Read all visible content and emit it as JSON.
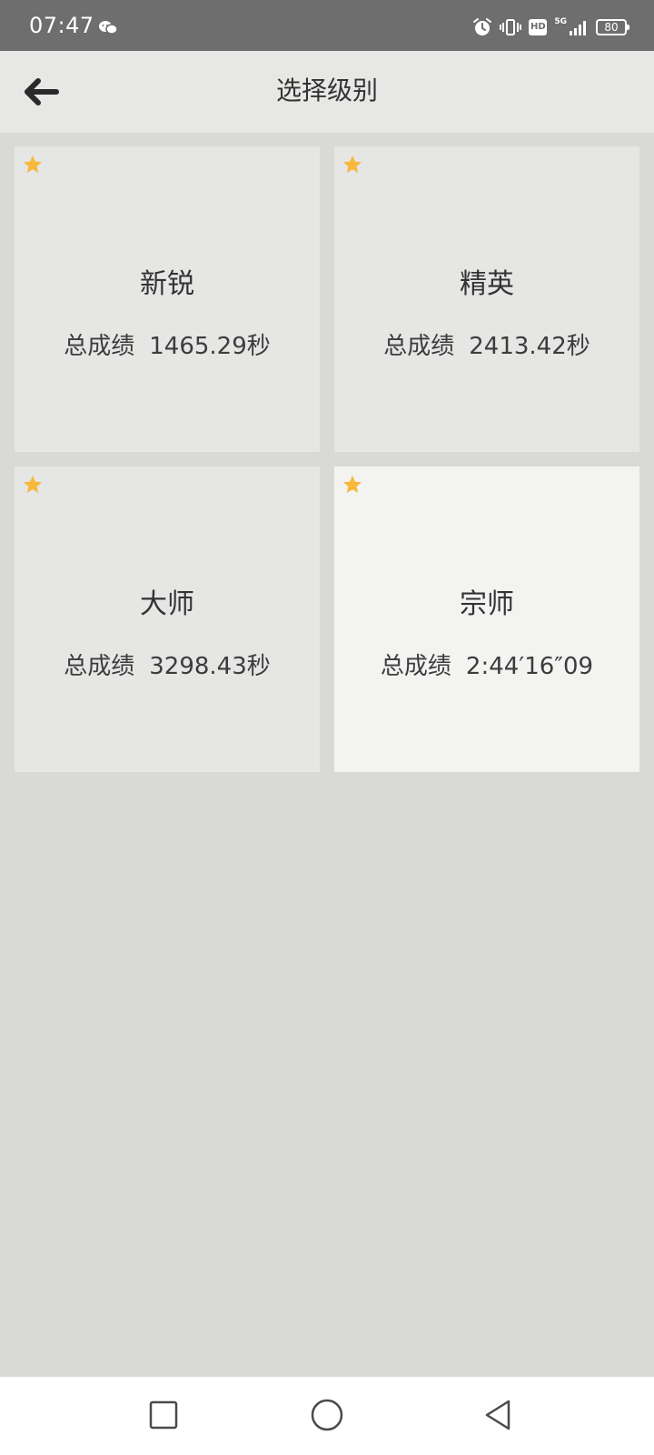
{
  "status_bar": {
    "time": "07:47",
    "network": "5G",
    "hd": "HD",
    "battery": "80",
    "icons": [
      "wechat-icon",
      "alarm-icon",
      "vibrate-icon",
      "hd-icon",
      "signal-icon",
      "battery-icon"
    ]
  },
  "header": {
    "title": "选择级别",
    "back_icon": "arrow-left-icon"
  },
  "levels": [
    {
      "name": "新锐",
      "score_label": "总成绩",
      "score": "1465.29秒",
      "starred": true,
      "selected": false
    },
    {
      "name": "精英",
      "score_label": "总成绩",
      "score": "2413.42秒",
      "starred": true,
      "selected": false
    },
    {
      "name": "大师",
      "score_label": "总成绩",
      "score": "3298.43秒",
      "starred": true,
      "selected": false
    },
    {
      "name": "宗师",
      "score_label": "总成绩",
      "score": "2:44′16″09",
      "starred": true,
      "selected": true
    }
  ],
  "nav_bar": {
    "icons": [
      "recents-square-icon",
      "home-circle-icon",
      "back-triangle-icon"
    ]
  },
  "colors": {
    "star": "#f6b93b",
    "status_bar": "#6e6e6e",
    "background": "#d9d9d8",
    "card": "#e6e6e5",
    "card_selected": "#f3f3f2"
  }
}
